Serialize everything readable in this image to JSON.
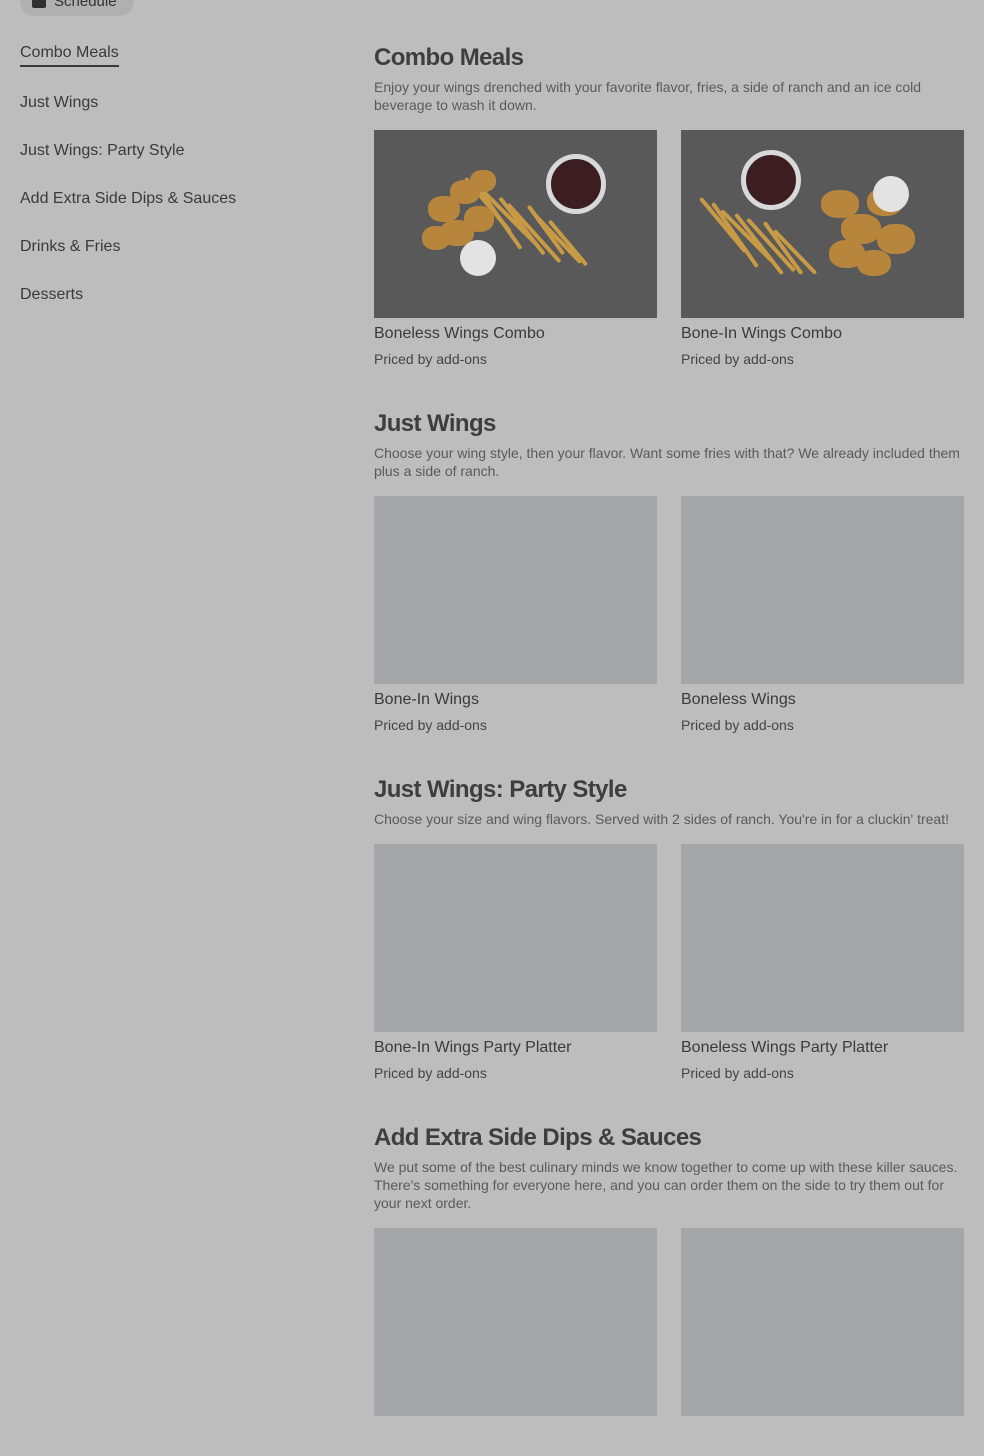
{
  "top_pill": {
    "label": "Schedule",
    "icon": "calendar-icon"
  },
  "sidebar": {
    "items": [
      {
        "label": "Combo Meals",
        "active": true
      },
      {
        "label": "Just Wings"
      },
      {
        "label": "Just Wings: Party Style"
      },
      {
        "label": "Add Extra Side Dips & Sauces"
      },
      {
        "label": "Drinks & Fries"
      },
      {
        "label": "Desserts"
      }
    ]
  },
  "sections": [
    {
      "title": "Combo Meals",
      "description": "Enjoy your wings drenched with your favorite flavor, fries, a side of ranch and an ice cold beverage to wash it down.",
      "items": [
        {
          "name": "Boneless Wings Combo",
          "price": "Priced by add-ons",
          "image": "photo-boneless"
        },
        {
          "name": "Bone-In Wings Combo",
          "price": "Priced by add-ons",
          "image": "photo-bonein"
        }
      ]
    },
    {
      "title": "Just Wings",
      "description": "Choose your wing style, then your flavor. Want some fries with that? We already included them plus a side of ranch.",
      "items": [
        {
          "name": "Bone-In Wings",
          "price": "Priced by add-ons"
        },
        {
          "name": "Boneless Wings",
          "price": "Priced by add-ons"
        }
      ]
    },
    {
      "title": "Just Wings: Party Style",
      "description": "Choose your size and wing flavors. Served with 2 sides of ranch. You're in for a cluckin' treat!",
      "items": [
        {
          "name": "Bone-In Wings Party Platter",
          "price": "Priced by add-ons"
        },
        {
          "name": "Boneless Wings Party Platter",
          "price": "Priced by add-ons"
        }
      ]
    },
    {
      "title": "Add Extra Side Dips & Sauces",
      "description": "We put some of the best culinary minds we know together to come up with these killer sauces. There's something for everyone here, and you can order them on the side to try them out for your next order.",
      "items": [
        {},
        {}
      ]
    }
  ]
}
